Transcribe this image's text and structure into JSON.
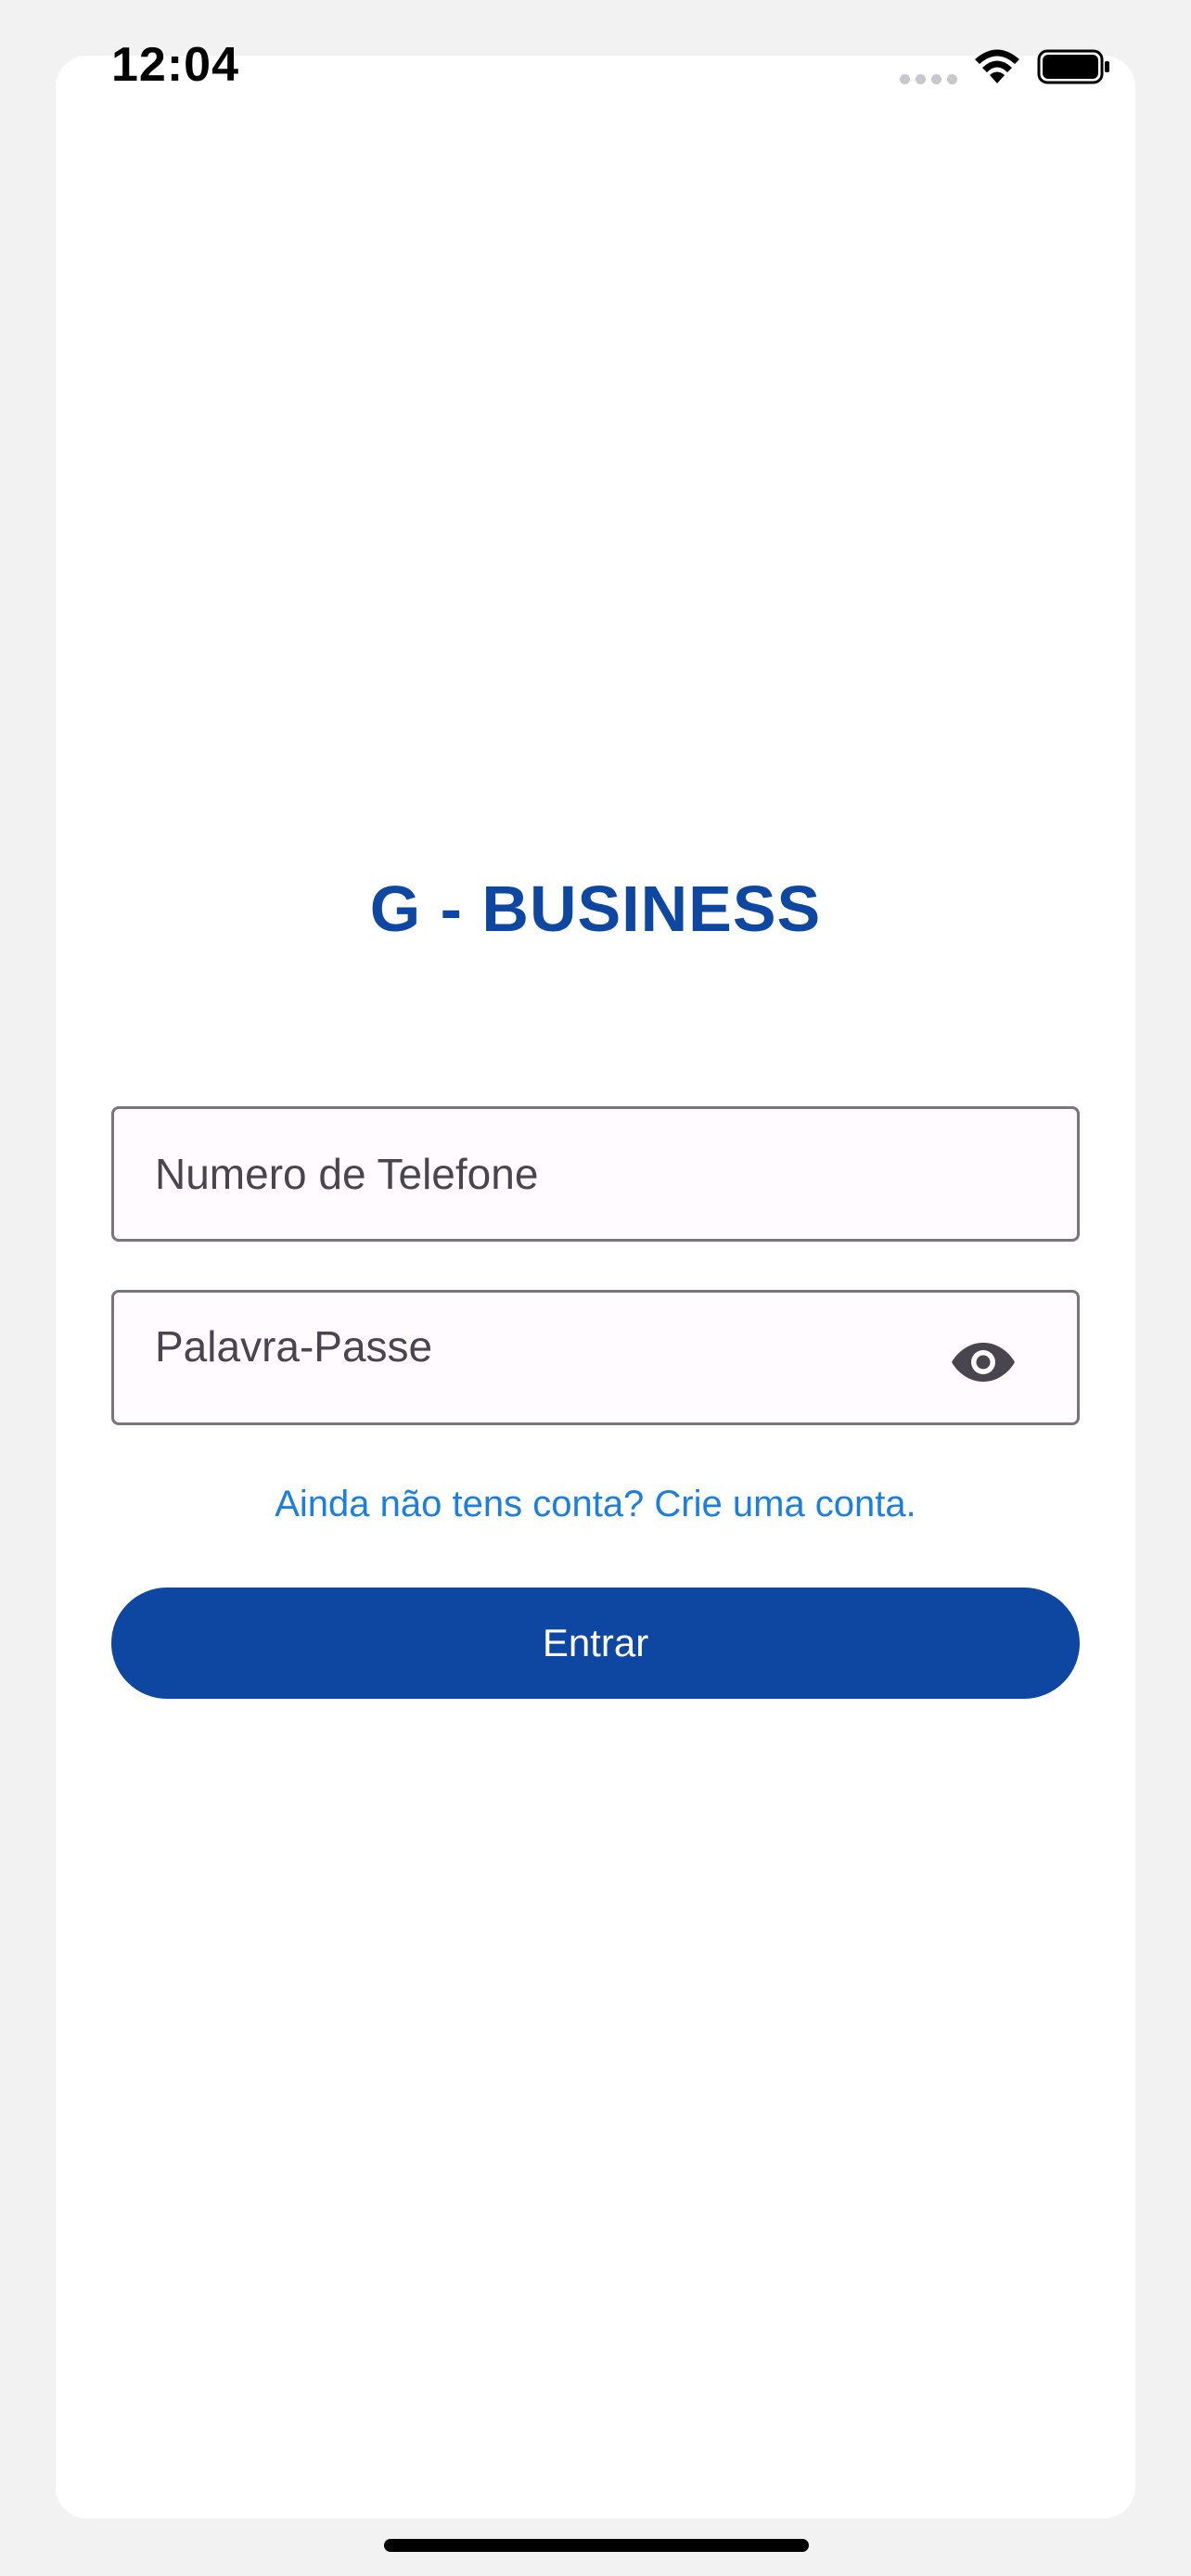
{
  "status_bar": {
    "time": "12:04",
    "icons": [
      "signal-dots-icon",
      "wifi-icon",
      "battery-icon"
    ]
  },
  "app": {
    "title": "G - BUSINESS"
  },
  "form": {
    "phone_placeholder": "Numero de Telefone",
    "phone_value": "",
    "password_placeholder": "Palavra-Passe",
    "password_value": "",
    "password_toggle_icon": "eye-icon",
    "signup_link": "Ainda não tens conta? Crie uma conta.",
    "submit_label": "Entrar"
  },
  "colors": {
    "brand": "#0d47a1",
    "link": "#1a7fe0",
    "field_background": "#fffbfe",
    "field_border": "#79747e",
    "page_background": "#f2f2f2"
  }
}
